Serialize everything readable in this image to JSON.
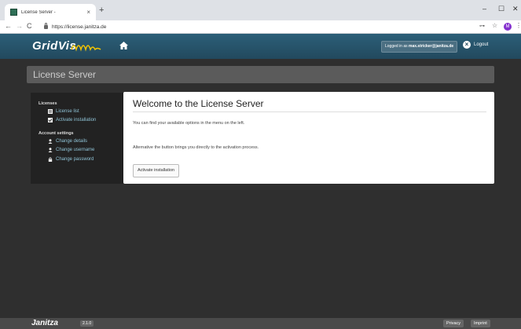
{
  "browser": {
    "tab_title": "License Server -",
    "tab_close": "×",
    "new_tab": "+",
    "minimize": "–",
    "maximize": "☐",
    "close": "✕",
    "back": "←",
    "forward": "→",
    "reload": "C",
    "url": "https://license.janitza.de",
    "profile_initial": "M",
    "menu": "⋮"
  },
  "header": {
    "logo": "GridVis",
    "logged_in_prefix": "Logged in as",
    "logged_in_user": "max.stricker@janitza.de",
    "logout_label": "Logout"
  },
  "banner": {
    "title": "License Server"
  },
  "sidebar": {
    "licenses_heading": "Licenses",
    "license_list": "License list",
    "activate_installation": "Activate installation",
    "account_heading": "Account settings",
    "change_details": "Change details",
    "change_username": "Change username",
    "change_password": "Change password"
  },
  "main": {
    "title": "Welcome to the License Server",
    "text1": "You can find your available options in the menu on the left.",
    "text2": "Alternative the button brings you directly to the activation process.",
    "button": "Activate installation"
  },
  "footer": {
    "logo": "Janitza",
    "version": "2.1.0",
    "privacy": "Privacy",
    "imprint": "Imprint"
  },
  "colors": {
    "header": "#22495e",
    "link": "#8fc3d6",
    "background": "#2f2f2f"
  }
}
